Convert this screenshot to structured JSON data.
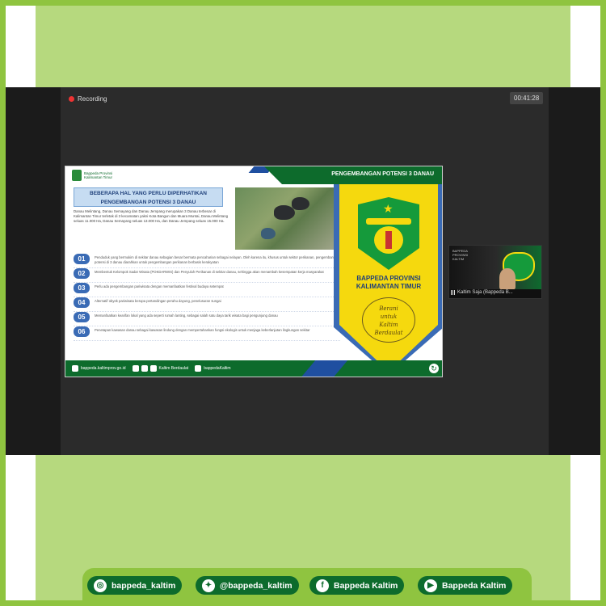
{
  "meeting": {
    "recording_label": "Recording",
    "timer": "00:41:28"
  },
  "slide": {
    "logo_text": "Bappeda Provinsi Kalimantan Timur",
    "header": "PENGEMBANGAN POTENSI 3 DANAU",
    "title_line1": "BEBERAPA HAL YANG PERLU DIPERHATIKAN",
    "title_line2": "PENGEMBANGAN POTENSI 3 DANAU",
    "intro": "Danau Melintang, Danau Semayang dan Danau Jempang merupakan 3 Danau terbesar di Kalimantan Timur terletak di 3 kecamatan yakni Kota Bangun dan Muara Muntai, Danau Melintang seluas 11.000 Ha, Danau Semayang seluas 13.000 Ha, dan Danau Jempang seluas 15.000 Ha.",
    "items": [
      {
        "num": "01",
        "text": "Penduduk yang bermukim di sekitar danau sebagian besar bermata pencaharian sebagai nelayan. Oleh karena itu, khusus untuk sektor perikanan, pengembangan potensi di 3 danau diarahkan untuk pengembangan perikanan berbasis kerakyatan"
      },
      {
        "num": "02",
        "text": "Membentuk Kelompok Sadar Wisata (POKDARWIS) dan Penyuluh Perikanan di sekitar danau, sehingga akan menambah kesempatan kerja masyarakat"
      },
      {
        "num": "03",
        "text": "Perlu ada pengembangan pariwisata dengan memanfaatkan festival budaya setempat"
      },
      {
        "num": "04",
        "text": "Alternatif obyek pariwisata berupa pertandingan perahu dayung, penelusuran sungai"
      },
      {
        "num": "05",
        "text": "Memanfaatkan kearifan lokal yang ada seperti rumah lanting, sebagai salah satu daya tarik wisata bagi pengunjung danau"
      },
      {
        "num": "06",
        "text": "Penetapan kawasan danau sebagai kawasan lindung dengan mempertahankan fungsi ekologis untuk menjaga keberlanjutan lingkungan sekitar"
      }
    ],
    "agency_line1": "BAPPEDA PROVINSI",
    "agency_line2": "KALIMANTAN TIMUR",
    "motto_line1": "Berani",
    "motto_line2": "untuk",
    "motto_line3": "Kaltim",
    "motto_line4": "Berdaulat",
    "footer": {
      "website": "bappeda.kaltimprov.go.id",
      "facebook": "Kaltim Berdaulat",
      "instagram": "bappedaKaltim"
    }
  },
  "participant": {
    "banner_line1": "BAPPEDA",
    "banner_line2": "PROVINSI",
    "banner_line3": "KALTIM",
    "name": "Kaltim Saja (Bappeda B..."
  },
  "social": {
    "instagram": "bappeda_kaltim",
    "twitter": "@bappeda_kaltim",
    "facebook": "Bappeda Kaltim",
    "youtube": "Bappeda Kaltim"
  }
}
